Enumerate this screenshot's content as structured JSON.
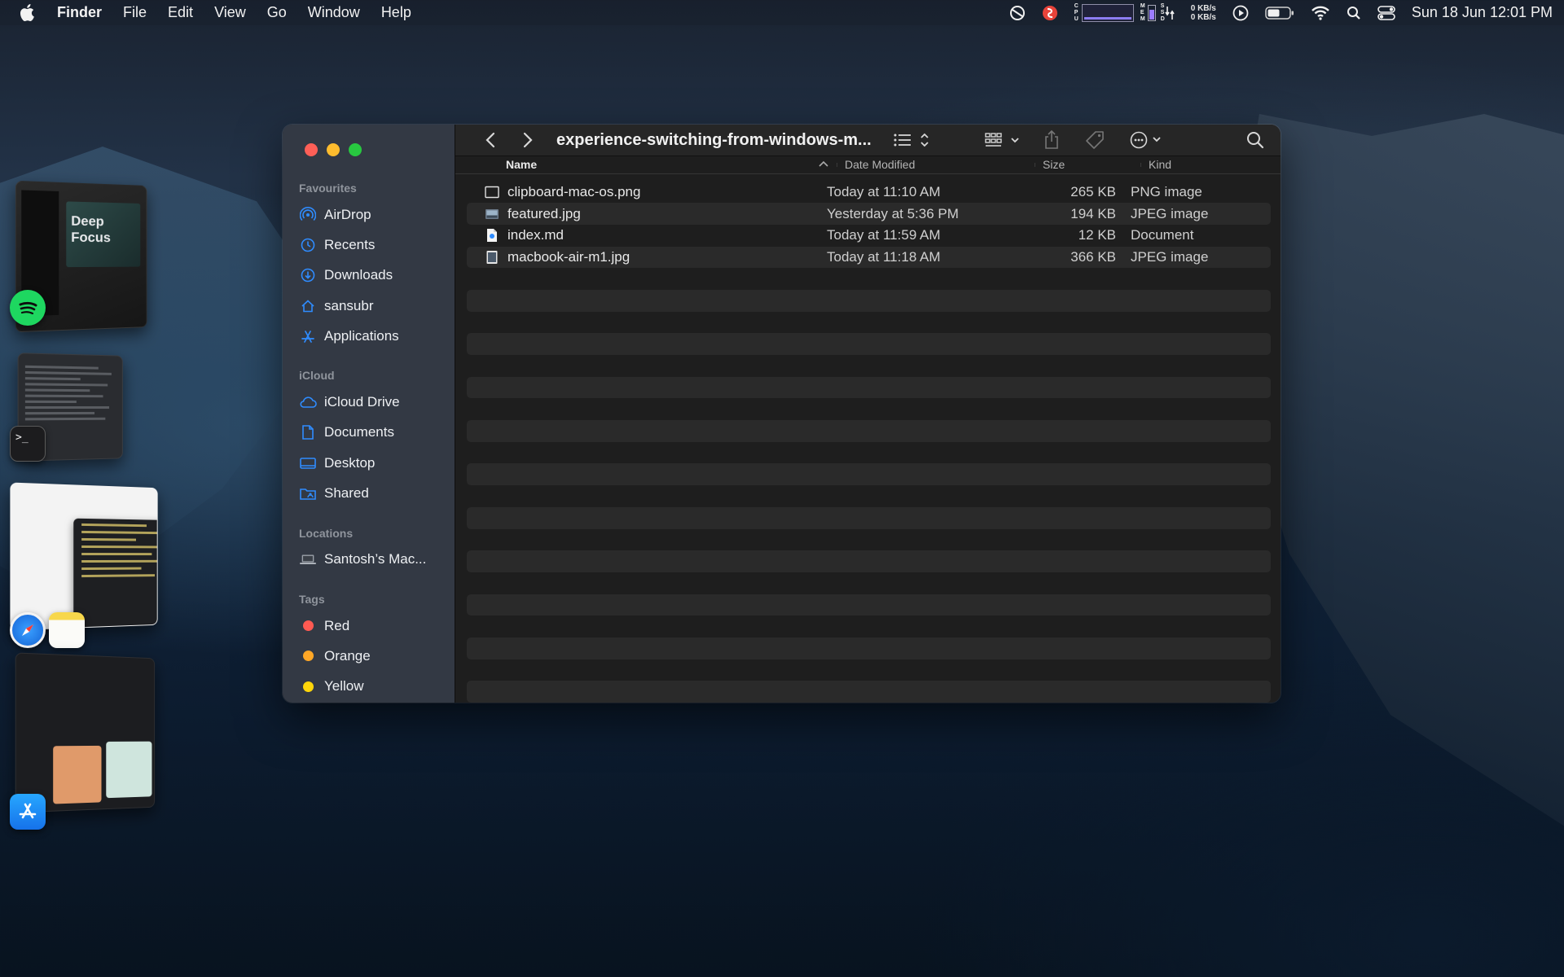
{
  "menubar": {
    "app_name": "Finder",
    "menus": [
      "File",
      "Edit",
      "View",
      "Go",
      "Window",
      "Help"
    ],
    "net_up": "0 KB/s",
    "net_down": "0 KB/s",
    "datetime": "Sun 18 Jun  12:01 PM",
    "status_icons": [
      "focus-icon",
      "scrobbles-icon",
      "cpu-graph",
      "memory-graph",
      "ssd-icon",
      "network-speed",
      "play-icon",
      "battery-icon",
      "wifi-icon",
      "spotlight-search-icon",
      "control-center-icon"
    ]
  },
  "stage_manager": {
    "spotify_cover_text": "Deep Focus"
  },
  "finder": {
    "title": "experience-switching-from-windows-m...",
    "sidebar": {
      "favourites_label": "Favourites",
      "favourites": [
        {
          "label": "AirDrop",
          "icon": "airdrop-icon"
        },
        {
          "label": "Recents",
          "icon": "clock-icon"
        },
        {
          "label": "Downloads",
          "icon": "download-icon"
        },
        {
          "label": "sansubr",
          "icon": "home-icon"
        },
        {
          "label": "Applications",
          "icon": "applications-icon"
        }
      ],
      "icloud_label": "iCloud",
      "icloud": [
        {
          "label": "iCloud Drive",
          "icon": "cloud-icon"
        },
        {
          "label": "Documents",
          "icon": "document-icon"
        },
        {
          "label": "Desktop",
          "icon": "desktop-icon"
        },
        {
          "label": "Shared",
          "icon": "shared-folder-icon"
        }
      ],
      "locations_label": "Locations",
      "locations": [
        {
          "label": "Santosh’s Mac...",
          "icon": "laptop-icon"
        }
      ],
      "tags_label": "Tags",
      "tags": [
        {
          "label": "Red",
          "color": "#ff5a52"
        },
        {
          "label": "Orange",
          "color": "#ffa726"
        },
        {
          "label": "Yellow",
          "color": "#ffd60a"
        }
      ]
    },
    "columns": {
      "name": "Name",
      "date": "Date Modified",
      "size": "Size",
      "kind": "Kind"
    },
    "files": [
      {
        "name": "clipboard-mac-os.png",
        "date": "Today at 11:10 AM",
        "size": "265 KB",
        "kind": "PNG image",
        "icon": "png-file-icon"
      },
      {
        "name": "featured.jpg",
        "date": "Yesterday at 5:36 PM",
        "size": "194 KB",
        "kind": "JPEG image",
        "icon": "jpg-file-icon"
      },
      {
        "name": "index.md",
        "date": "Today at 11:59 AM",
        "size": "12 KB",
        "kind": "Document",
        "icon": "markdown-file-icon"
      },
      {
        "name": "macbook-air-m1.jpg",
        "date": "Today at 11:18 AM",
        "size": "366 KB",
        "kind": "JPEG image",
        "icon": "jpg-file-icon"
      }
    ]
  }
}
